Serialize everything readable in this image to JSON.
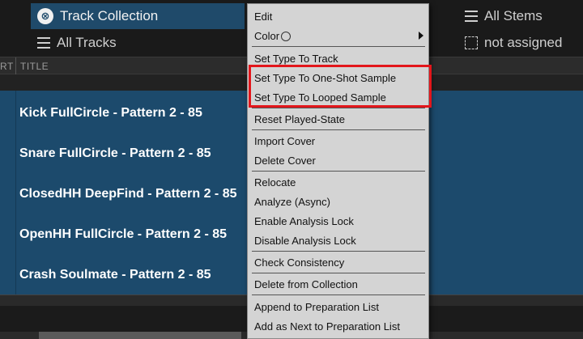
{
  "header": {
    "collection_label": "Track Collection",
    "all_tracks_label": "All Tracks",
    "all_stems_label": "All Stems",
    "not_assigned_label": "not assigned"
  },
  "columns": {
    "left_partial": "RT",
    "title": "TITLE"
  },
  "tracks": [
    "Kick FullCircle - Pattern 2 - 85",
    "Snare FullCircle - Pattern 2 - 85",
    "ClosedHH DeepFind - Pattern 2 - 85",
    "OpenHH FullCircle - Pattern 2 - 85",
    "Crash Soulmate - Pattern 2 - 85"
  ],
  "context_menu": {
    "items": [
      "Edit",
      "Color",
      "Set Type To Track",
      "Set Type To One-Shot Sample",
      "Set Type To Looped Sample",
      "Reset Played-State",
      "Import Cover",
      "Delete Cover",
      "Relocate",
      "Analyze (Async)",
      "Enable Analysis Lock",
      "Disable Analysis Lock",
      "Check Consistency",
      "Delete from Collection",
      "Append to Preparation List",
      "Add as Next to Preparation List"
    ]
  },
  "colors": {
    "selected_row_bg": "#1c4a6c",
    "menu_bg": "#d4d4d4",
    "highlight_border": "#e3161b"
  }
}
